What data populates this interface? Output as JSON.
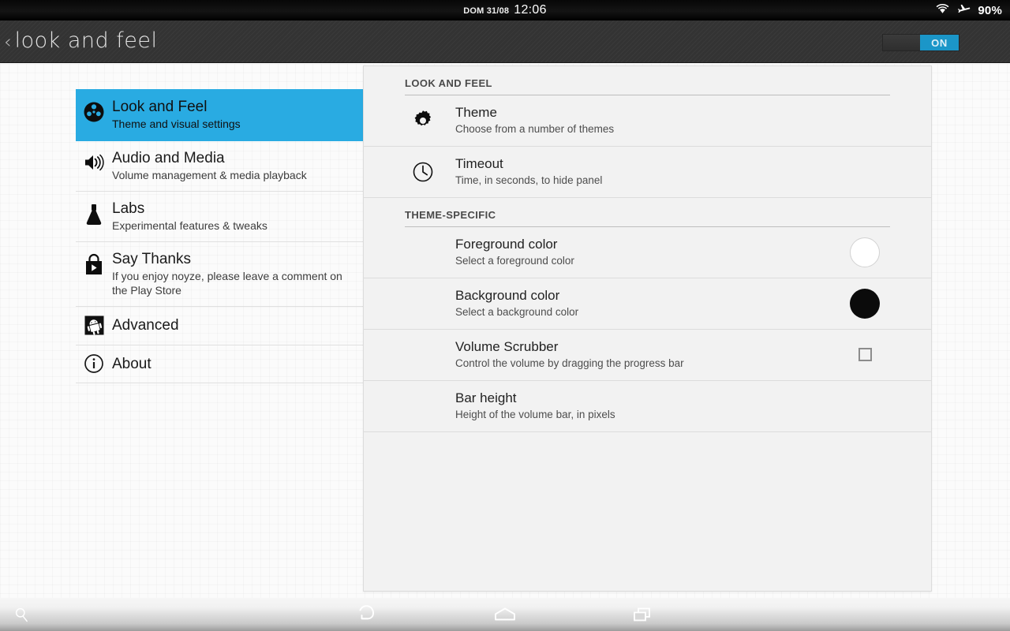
{
  "status_bar": {
    "date": "DOM 31/08",
    "time": "12:06",
    "battery": "90%",
    "wifi_icon": "wifi-icon",
    "airplane_icon": "airplane-mode-icon"
  },
  "action_bar": {
    "back_icon": "back-chevron-icon",
    "title": "look and feel",
    "toggle_label": "ON",
    "accent_color": "#1b96c8"
  },
  "sidebar": {
    "items": [
      {
        "icon": "film-reel-icon",
        "title": "Look and Feel",
        "subtitle": "Theme and visual settings",
        "selected": true
      },
      {
        "icon": "speaker-volume-icon",
        "title": "Audio and Media",
        "subtitle": "Volume management & media playback",
        "selected": false
      },
      {
        "icon": "lab-flask-icon",
        "title": "Labs",
        "subtitle": "Experimental features & tweaks",
        "selected": false
      },
      {
        "icon": "play-store-icon",
        "title": "Say Thanks",
        "subtitle": "If you enjoy noyze, please leave a comment on the Play Store",
        "selected": false
      },
      {
        "icon": "android-robot-icon",
        "title": "Advanced",
        "subtitle": "",
        "selected": false
      },
      {
        "icon": "info-circle-icon",
        "title": "About",
        "subtitle": "",
        "selected": false
      }
    ],
    "selected_color": "#29abe2"
  },
  "content": {
    "sections": [
      {
        "header": "LOOK AND FEEL",
        "rows": [
          {
            "icon": "gear-icon",
            "title": "Theme",
            "subtitle": "Choose from a number of themes",
            "widget": "none"
          },
          {
            "icon": "clock-icon",
            "title": "Timeout",
            "subtitle": "Time, in seconds, to hide panel",
            "widget": "none"
          }
        ]
      },
      {
        "header": "THEME-SPECIFIC",
        "rows": [
          {
            "icon": "none",
            "title": "Foreground color",
            "subtitle": "Select a foreground color",
            "widget": "color-swatch",
            "widget_color": "#ffffff"
          },
          {
            "icon": "none",
            "title": "Background color",
            "subtitle": "Select a background color",
            "widget": "color-swatch",
            "widget_color": "#0b0b0b"
          },
          {
            "icon": "none",
            "title": "Volume Scrubber",
            "subtitle": "Control the volume by dragging the progress bar",
            "widget": "checkbox",
            "widget_checked": false
          },
          {
            "icon": "none",
            "title": "Bar height",
            "subtitle": "Height of the volume bar, in pixels",
            "widget": "none"
          }
        ]
      }
    ]
  },
  "nav_bar": {
    "search_icon": "search-icon",
    "back_icon": "back-icon",
    "home_icon": "home-icon",
    "recents_icon": "recent-apps-icon"
  }
}
